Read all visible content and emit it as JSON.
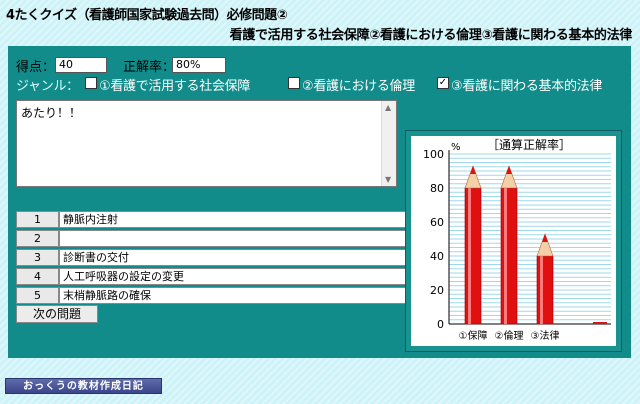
{
  "app": {
    "title": "4たくクイズ（看護師国家試験過去問）必修問題②",
    "subtitle": "看護で活用する社会保障②看護における倫理③看護に関わる基本的法律"
  },
  "score": {
    "label": "得点：",
    "value": "40"
  },
  "accuracy": {
    "label": "正解率：",
    "value": "80%"
  },
  "genre": {
    "label": "ジャンル：",
    "options": [
      {
        "label": "①看護で活用する社会保障",
        "checked": false
      },
      {
        "label": "②看護における倫理",
        "checked": false
      },
      {
        "label": "③看護に関わる基本的法律",
        "checked": true
      }
    ]
  },
  "answer_area": {
    "text": "あたり！！"
  },
  "choices": [
    {
      "num": "1",
      "text": "静脈内注射"
    },
    {
      "num": "2",
      "text": ""
    },
    {
      "num": "3",
      "text": "診断書の交付"
    },
    {
      "num": "4",
      "text": "人工呼吸器の設定の変更"
    },
    {
      "num": "5",
      "text": "末梢静脈路の確保"
    }
  ],
  "next_button": {
    "label": "次の問題"
  },
  "chart_data": {
    "type": "bar",
    "title": "［通算正解率］",
    "unit": "%",
    "ylim": [
      0,
      100
    ],
    "yticks": [
      "0",
      "20",
      "40",
      "60",
      "80",
      "100"
    ],
    "categories": [
      "①保障",
      "②倫理",
      "③法律"
    ],
    "values": [
      80,
      80,
      40
    ],
    "bar_color": "#e01010"
  },
  "footer": {
    "label": "おっくうの教材作成日記"
  }
}
